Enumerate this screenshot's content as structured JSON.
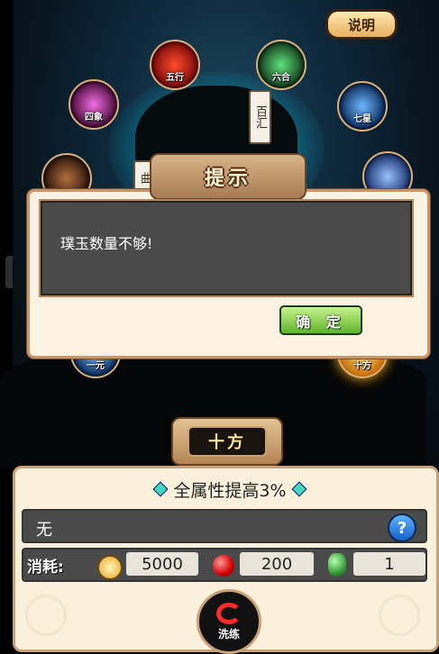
{
  "help_button": {
    "label": "说明"
  },
  "orbs": [
    {
      "label": "五行",
      "color": "#c81e1e"
    },
    {
      "label": "六合",
      "color": "#2fb046"
    },
    {
      "label": "四象",
      "color": "#c23aa5"
    },
    {
      "label": "七星",
      "color": "#1f6fd6"
    },
    {
      "label": "",
      "color": "#6b3a1a"
    },
    {
      "label": "",
      "color": "#3a67c8"
    },
    {
      "label": "一元",
      "color": "#2a66b8"
    },
    {
      "label": "十方",
      "color": "#e8a62a"
    }
  ],
  "scrolls": {
    "right": "百汇",
    "left": "曲"
  },
  "dialog": {
    "title": "提示",
    "message": "璞玉数量不够!",
    "ok_label": "确 定"
  },
  "tenway_button": {
    "label": "十方"
  },
  "panel": {
    "title": "全属性提高3%",
    "attribute_value": "无",
    "help_icon": "?",
    "cost_label": "消耗:",
    "costs": [
      {
        "icon": "coin-icon",
        "value": "5000"
      },
      {
        "icon": "ruby-icon",
        "value": "200"
      },
      {
        "icon": "jade-icon",
        "value": "1"
      }
    ],
    "wash_label": "洗练"
  }
}
